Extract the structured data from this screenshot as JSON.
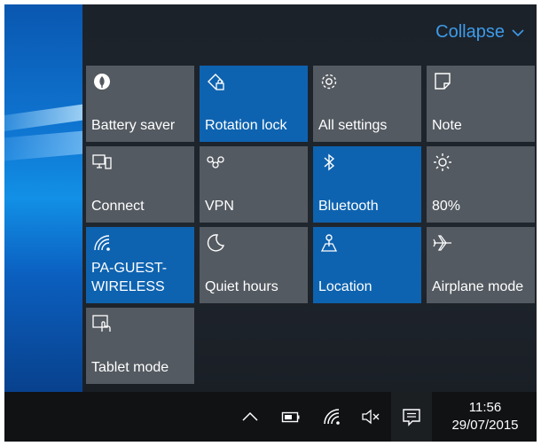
{
  "panel": {
    "collapse_label": "Collapse",
    "accent_color": "#3d9be9",
    "tile_on_color": "#0e63b0",
    "tile_off_color": "#545a61"
  },
  "tiles": [
    {
      "label": "Battery saver",
      "icon": "battery-saver-icon",
      "active": false
    },
    {
      "label": "Rotation lock",
      "icon": "rotation-lock-icon",
      "active": true
    },
    {
      "label": "All settings",
      "icon": "gear-icon",
      "active": false
    },
    {
      "label": "Note",
      "icon": "note-icon",
      "active": false
    },
    {
      "label": "Connect",
      "icon": "connect-icon",
      "active": false
    },
    {
      "label": "VPN",
      "icon": "vpn-icon",
      "active": false
    },
    {
      "label": "Bluetooth",
      "icon": "bluetooth-icon",
      "active": true
    },
    {
      "label": "80%",
      "icon": "brightness-icon",
      "active": false
    },
    {
      "label": "PA-GUEST-\nWIRELESS",
      "icon": "wifi-icon",
      "active": true
    },
    {
      "label": "Quiet hours",
      "icon": "moon-icon",
      "active": false
    },
    {
      "label": "Location",
      "icon": "location-icon",
      "active": true
    },
    {
      "label": "Airplane mode",
      "icon": "airplane-icon",
      "active": false
    },
    {
      "label": "Tablet mode",
      "icon": "tablet-mode-icon",
      "active": false
    }
  ],
  "taskbar": {
    "tray_icons": [
      "chevron-up-icon",
      "battery-icon",
      "wifi-icon",
      "volume-muted-icon"
    ],
    "action_center_icon": "action-center-icon",
    "time": "11:56",
    "date": "29/07/2015"
  }
}
